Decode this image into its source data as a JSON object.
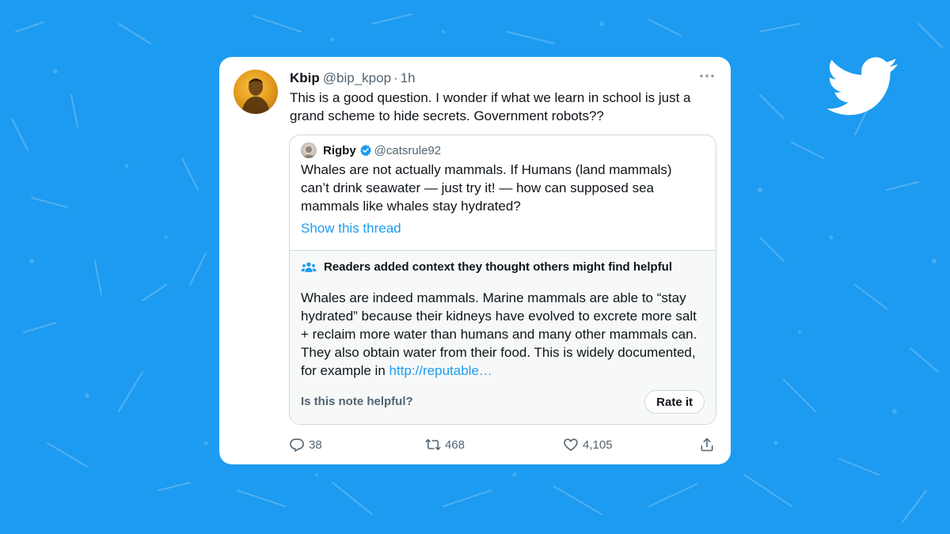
{
  "colors": {
    "brand": "#1d9bf0",
    "text": "#0f1419",
    "secondary": "#536471",
    "border": "#cfd9de",
    "note_bg": "#f7f9f9"
  },
  "tweet": {
    "author_name": "Kbip",
    "author_handle": "@bip_kpop",
    "separator": "·",
    "time": "1h",
    "text": "This is a good question. I wonder if what we learn in school is just a grand scheme to hide secrets. Government robots??"
  },
  "quoted_tweet": {
    "author_name": "Rigby",
    "author_handle": "@catsrule92",
    "text": "Whales are not actually mammals. If Humans (land mammals) can’t drink seawater — just try it! — how can supposed sea mammals like whales stay hydrated?",
    "thread_link": "Show this thread"
  },
  "community_note": {
    "header": "Readers added context they thought others might find helpful",
    "text": "Whales are indeed mammals. Marine mammals are able to “stay hydrated” because their kidneys have evolved to excrete more salt + reclaim more water than humans and many other mammals can. They also obtain water from their food. This is widely documented, for example in ",
    "link": "http://reputable…",
    "helpful_question": "Is this note helpful?",
    "rate_button": "Rate it"
  },
  "actions": {
    "replies": "38",
    "retweets": "468",
    "likes": "4,105"
  },
  "icons": {
    "brand_logo": "twitter-bird-icon",
    "menu": "more-icon",
    "verified": "verified-badge-icon",
    "note": "people-icon",
    "reply": "reply-icon",
    "retweet": "retweet-icon",
    "like": "heart-icon",
    "share": "share-icon"
  }
}
